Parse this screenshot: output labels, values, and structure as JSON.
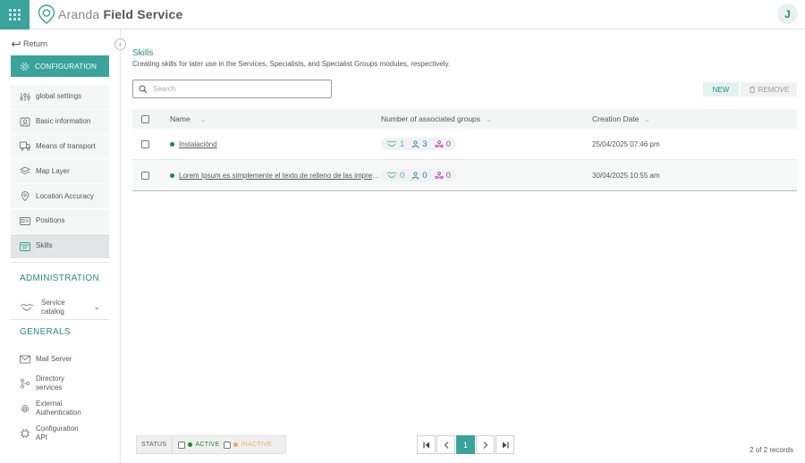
{
  "header": {
    "brand_light": "Aranda",
    "brand_bold": "Field Service",
    "avatar_initial": "J",
    "accent_color": "#3aa39b"
  },
  "sidebar": {
    "return_label": "Return",
    "config_label": "CONFIGURATION",
    "config_items": [
      {
        "label": "global settings",
        "icon": "sliders-icon"
      },
      {
        "label": "Basic information",
        "icon": "user-id-icon"
      },
      {
        "label": "Means of transport",
        "icon": "truck-icon"
      },
      {
        "label": "Map Layer",
        "icon": "map-layers-icon"
      },
      {
        "label": "Location Accuracy",
        "icon": "location-pin-icon"
      },
      {
        "label": "Positions",
        "icon": "id-card-icon"
      },
      {
        "label": "Skills",
        "icon": "skills-calendar-icon",
        "selected": true
      }
    ],
    "administration_title": "ADMINISTRATION",
    "service_catalog_label": "Service catalog",
    "generals_title": "GENERALS",
    "general_items": [
      {
        "label": "Mail Server",
        "icon": "mail-icon"
      },
      {
        "label": "Directory services",
        "icon": "directory-tree-icon"
      },
      {
        "label": "External Authentication",
        "icon": "fingerprint-icon"
      },
      {
        "label": "Configuration API",
        "icon": "api-chip-icon"
      }
    ]
  },
  "main": {
    "title": "Skills",
    "subtitle": "Creating skills for later use in the Services, Specialists, and Specialist Groups modules, respectively.",
    "search_placeholder": "Search",
    "new_label": "NEW",
    "remove_label": "REMOVE",
    "columns": {
      "name": "Name",
      "groups": "Number of associated groups",
      "date": "Creation Date"
    },
    "rows": [
      {
        "name": "Instalaciónd",
        "services": "1",
        "specialists": "3",
        "groups": "0",
        "date": "25/04/2025 07:46 pm",
        "status": "active"
      },
      {
        "name": "Lorem Ipsum es simplemente el texto de relleno de las imprentas y archivos de texto",
        "services": "0",
        "specialists": "0",
        "groups": "0",
        "date": "30/04/2025 10:55 am",
        "status": "active"
      }
    ]
  },
  "footer": {
    "status_label": "STATUS",
    "active_label": "ACTIVE",
    "inactive_label": "INACTIVE",
    "current_page": "1",
    "records_text": "2 of 2 records"
  }
}
